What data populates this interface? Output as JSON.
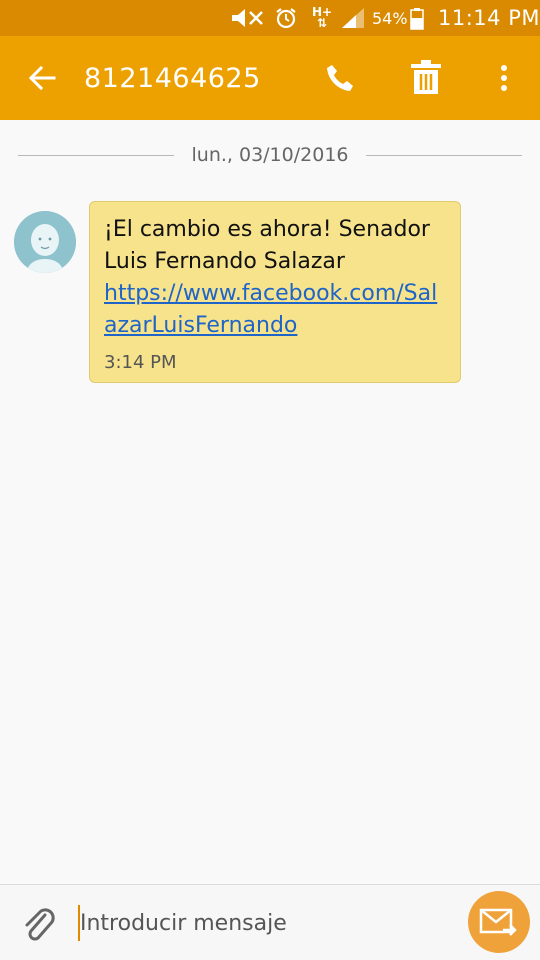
{
  "status_bar": {
    "network": "H+",
    "battery_percent": "54%",
    "time": "11:14 PM",
    "icons": [
      "mute-icon",
      "alarm-icon",
      "network-arrows-icon",
      "signal-icon",
      "battery-icon"
    ]
  },
  "app_bar": {
    "contact": "8121464625",
    "icons": [
      "back-arrow-icon",
      "phone-icon",
      "trash-icon",
      "more-vert-icon"
    ]
  },
  "conversation": {
    "date": "lun., 03/10/2016",
    "messages": [
      {
        "text": "¡El cambio es ahora!  Senador Luis Fernando Salazar",
        "link": "https://www.facebook.com/SalazarLuisFernando",
        "time": "3:14 PM"
      }
    ]
  },
  "composer": {
    "placeholder": "Introducir mensaje",
    "value": "",
    "icons": [
      "paperclip-icon",
      "send-envelope-icon"
    ]
  },
  "colors": {
    "status_bar": "#d98a00",
    "app_bar": "#eda100",
    "bubble": "#f6e38c",
    "link": "#1f64c8",
    "send_button": "#f0a23a"
  }
}
